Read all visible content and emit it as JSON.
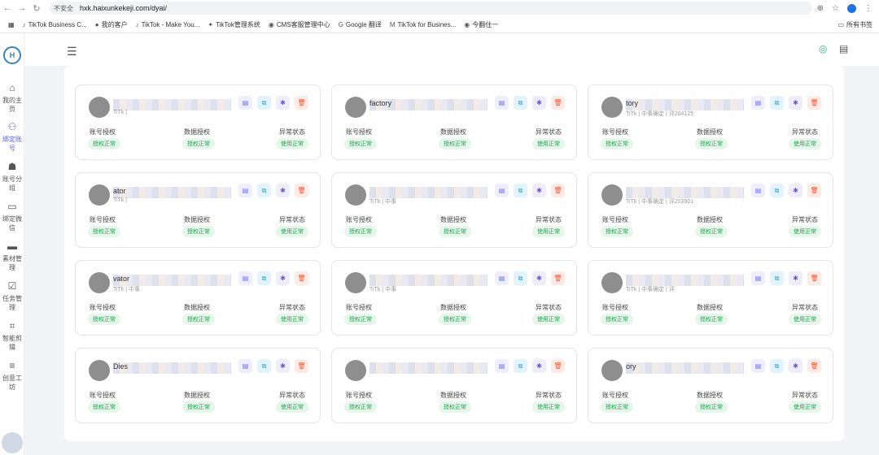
{
  "browser": {
    "security_label": "不安全",
    "url": "hxk.haixunkekeji.com/dyai/",
    "bookmarks": [
      "TikTok Business C...",
      "我的客户",
      "TikTok - Make You...",
      "TikTok管理系统",
      "CMS客服管理中心",
      "Google 翻译",
      "TikTok for Busines...",
      "今翻住一"
    ],
    "bookmarks_folder": "所有书签"
  },
  "sidebar": {
    "logo": "H",
    "items": [
      {
        "label": "我的主页",
        "icon": "home-icon",
        "glyph": "⌂"
      },
      {
        "label": "绑定账号",
        "icon": "add-user-icon",
        "glyph": "⚇"
      },
      {
        "label": "账号分组",
        "icon": "group-icon",
        "glyph": "☗"
      },
      {
        "label": "绑定微信",
        "icon": "chat-icon",
        "glyph": "▭"
      },
      {
        "label": "素材管理",
        "icon": "folder-icon",
        "glyph": "▬"
      },
      {
        "label": "任务管理",
        "icon": "clipboard-icon",
        "glyph": "☑"
      },
      {
        "label": "智能剪辑",
        "icon": "crop-icon",
        "glyph": "⌗"
      },
      {
        "label": "创意工坊",
        "icon": "sliders-icon",
        "glyph": "≡"
      }
    ]
  },
  "header": {
    "menu_glyph": "☰",
    "wechat_glyph": "◎",
    "doc_glyph": "▤"
  },
  "card_labels": {
    "auth": "账号授权",
    "data": "数据授权",
    "status": "异常状态",
    "auth_ok": "授权正常",
    "data_ok": "授权正常",
    "status_ok": "使用正常"
  },
  "action_glyphs": {
    "edit": "▤",
    "copy": "⧉",
    "gear": "✱",
    "delete": "🗑"
  },
  "cards": [
    {
      "name": "",
      "sub": "TiTk |"
    },
    {
      "name": "factory",
      "sub": ""
    },
    {
      "name": "tory",
      "sub": "TiTk | 中事确定 | 评204125"
    },
    {
      "name": "ator",
      "sub": "TiTk |"
    },
    {
      "name": "",
      "sub": "TiTk | 中事"
    },
    {
      "name": "",
      "sub": "TiTk | 中事确定 | 评203901"
    },
    {
      "name": "vator",
      "sub": "TiTk | 中事"
    },
    {
      "name": "",
      "sub": "TiTk | 中事"
    },
    {
      "name": "",
      "sub": "TiTk | 中事确定 | 评"
    },
    {
      "name": "Dies",
      "sub": ""
    },
    {
      "name": "",
      "sub": ""
    },
    {
      "name": "ory",
      "sub": ""
    }
  ]
}
